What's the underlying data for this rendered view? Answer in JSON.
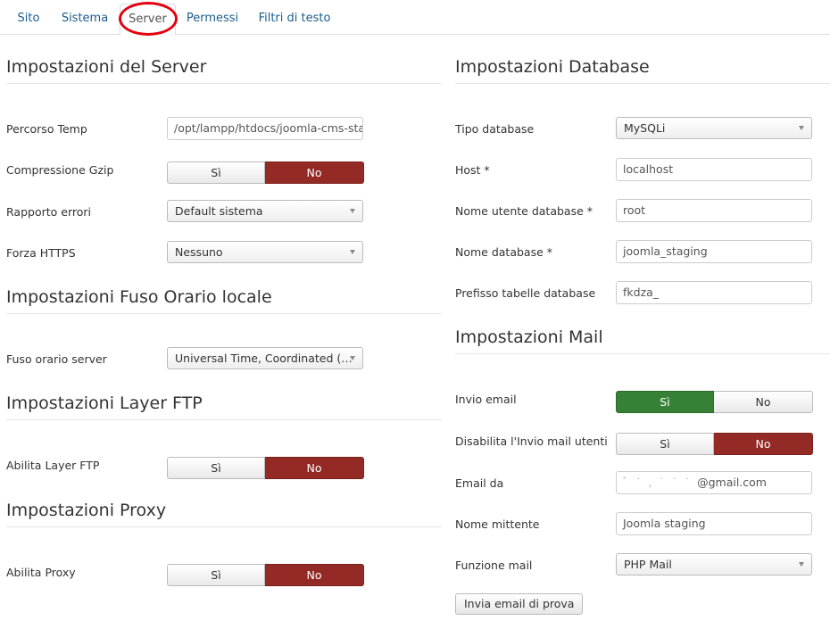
{
  "tabs": {
    "sito": "Sito",
    "sistema": "Sistema",
    "server": "Server",
    "permessi": "Permessi",
    "filtri": "Filtri di testo",
    "active_tab": "Server"
  },
  "colors": {
    "link": "#1a5c8e",
    "toggle_no_active": "#942a25",
    "toggle_si_active": "#378137",
    "highlight_ring": "#e3000f"
  },
  "server": {
    "title": "Impostazioni del Server",
    "percorso_temp_label": "Percorso Temp",
    "percorso_temp_value": "/opt/lampp/htdocs/joomla-cms-stagi",
    "gzip_label": "Compressione Gzip",
    "gzip_si": "Sì",
    "gzip_no": "No",
    "rapporto_errori_label": "Rapporto errori",
    "rapporto_errori_value": "Default sistema",
    "https_label": "Forza HTTPS",
    "https_value": "Nessuno"
  },
  "fuso": {
    "title": "Impostazioni Fuso Orario locale",
    "label": "Fuso orario server",
    "value": "Universal Time, Coordinated (…"
  },
  "ftp": {
    "title": "Impostazioni Layer FTP",
    "label": "Abilita Layer FTP",
    "si": "Sì",
    "no": "No"
  },
  "proxy": {
    "title": "Impostazioni Proxy",
    "label": "Abilita Proxy",
    "si": "Sì",
    "no": "No"
  },
  "database": {
    "title": "Impostazioni Database",
    "tipo_label": "Tipo database",
    "tipo_value": "MySQLi",
    "host_label": "Host *",
    "host_value": "localhost",
    "utente_label": "Nome utente database *",
    "utente_value": "root",
    "nome_label": "Nome database *",
    "nome_value": "joomla_staging",
    "prefisso_label": "Prefisso tabelle database",
    "prefisso_value": "fkdza_"
  },
  "mail": {
    "title": "Impostazioni Mail",
    "invio_label": "Invio email",
    "invio_si": "Sì",
    "invio_no": "No",
    "disabilita_label": "Disabilita l'Invio mail utenti",
    "disabilita_si": "Sì",
    "disabilita_no": "No",
    "email_da_label": "Email da",
    "email_da_obscured": "ﾞ ˙ ,   ˙  ˙ ˙ ",
    "email_da_value": "@gmail.com",
    "mittente_label": "Nome mittente",
    "mittente_value": "Joomla staging",
    "funzione_label": "Funzione mail",
    "funzione_value": "PHP Mail",
    "test_button": "Invia email di prova"
  }
}
